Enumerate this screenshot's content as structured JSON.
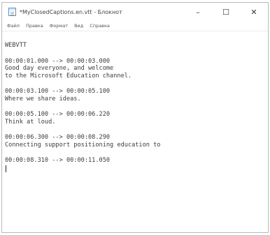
{
  "window": {
    "title": "*MyClosedCaptions.en.vtt - Блокнот",
    "controls": {
      "minimize": "–",
      "maximize": "☐",
      "close": "✕"
    }
  },
  "menu": [
    "Файл",
    "Правка",
    "Формат",
    "Вид",
    "Справка"
  ],
  "document": {
    "header": "WEBVTT",
    "cues": [
      {
        "timing": "00:00:01.000 --> 00:00:03.000",
        "text": [
          "Good day everyone, and welcome",
          "to the Microsoft Education channel."
        ]
      },
      {
        "timing": "00:00:03.100 --> 00:00:05.100",
        "text": [
          "Where we share ideas."
        ]
      },
      {
        "timing": "00:00:05.100 --> 00:00:06.220",
        "text": [
          "Think at loud."
        ]
      },
      {
        "timing": "00:00:06.300 --> 00:00:08.290",
        "text": [
          "Connecting support positioning education to"
        ]
      },
      {
        "timing": "00:00:08.310 --> 00:00:11.050",
        "text": []
      }
    ]
  }
}
